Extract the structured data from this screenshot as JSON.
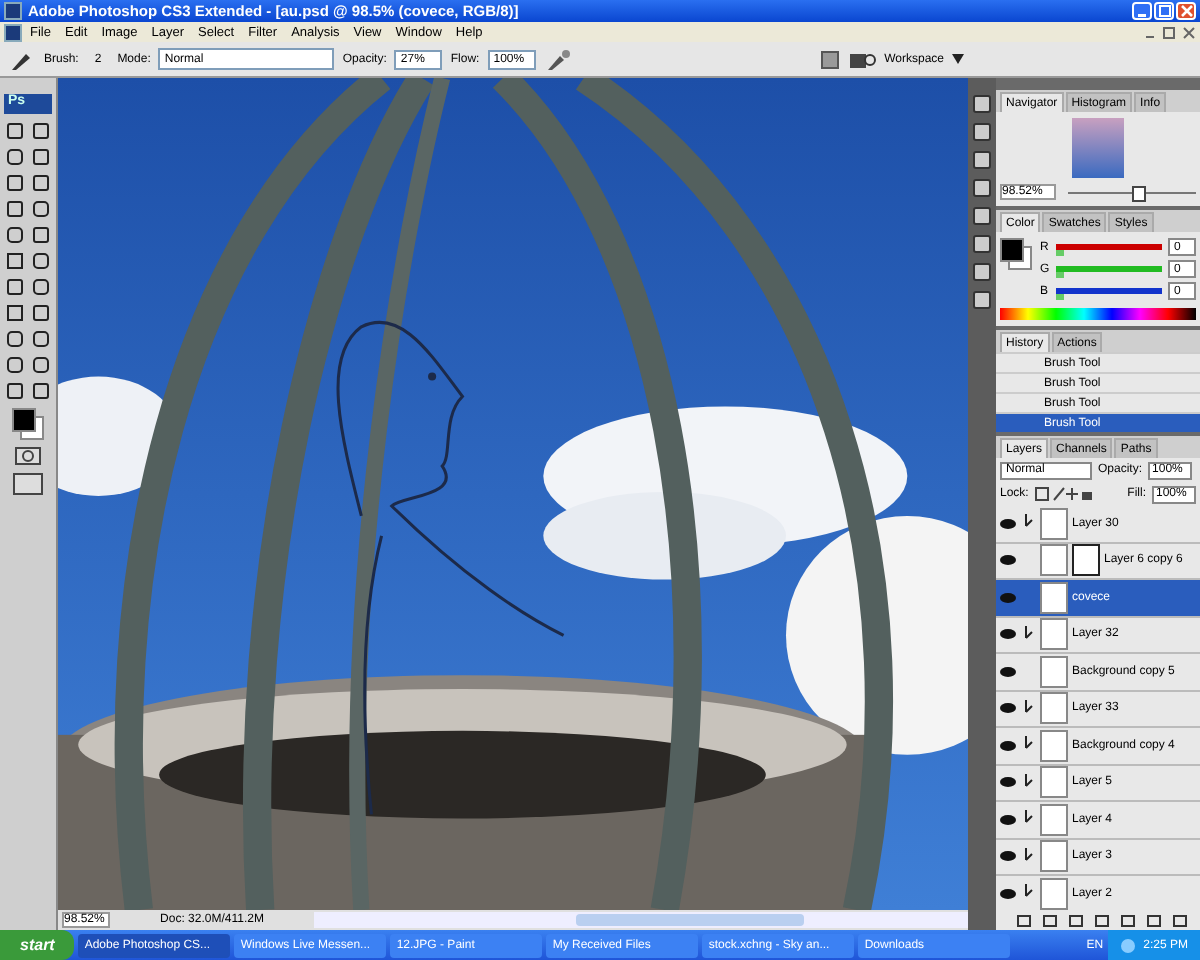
{
  "window": {
    "title": "Adobe Photoshop CS3 Extended - [au.psd @ 98.5% (covece, RGB/8)]"
  },
  "menu": [
    "File",
    "Edit",
    "Image",
    "Layer",
    "Select",
    "Filter",
    "Analysis",
    "View",
    "Window",
    "Help"
  ],
  "options_bar": {
    "brush_label": "Brush:",
    "brush_size": "2",
    "mode_label": "Mode:",
    "mode": "Normal",
    "opacity_label": "Opacity:",
    "opacity": "27%",
    "flow_label": "Flow:",
    "flow": "100%",
    "workspace": "Workspace"
  },
  "toolbox": {
    "logo": "Ps"
  },
  "navigator": {
    "tabs": [
      {
        "label": "Navigator",
        "selected": true
      },
      {
        "label": "Histogram",
        "selected": false
      },
      {
        "label": "Info",
        "selected": false
      }
    ],
    "zoom": "98.52%",
    "level": 0.55
  },
  "color": {
    "tabs": [
      {
        "label": "Color",
        "selected": true
      },
      {
        "label": "Swatches",
        "selected": false
      },
      {
        "label": "Styles",
        "selected": false
      }
    ],
    "channels": [
      {
        "name": "R",
        "value": "0",
        "color": "#cc0000",
        "level": 0
      },
      {
        "name": "G",
        "value": "0",
        "color": "#22bb22",
        "level": 0
      },
      {
        "name": "B",
        "value": "0",
        "color": "#1133cc",
        "level": 0
      }
    ]
  },
  "history": {
    "tabs": [
      {
        "label": "History",
        "selected": true
      },
      {
        "label": "Actions",
        "selected": false
      }
    ],
    "items": [
      {
        "label": "Brush Tool",
        "selected": false
      },
      {
        "label": "Brush Tool",
        "selected": false
      },
      {
        "label": "Brush Tool",
        "selected": false
      },
      {
        "label": "Brush Tool",
        "selected": true
      }
    ]
  },
  "layers": {
    "tabs": [
      {
        "label": "Layers",
        "selected": true
      },
      {
        "label": "Channels",
        "selected": false
      },
      {
        "label": "Paths",
        "selected": false
      }
    ],
    "blend_mode": "Normal",
    "opacity_label": "Opacity:",
    "opacity": "100%",
    "lock_label": "Lock:",
    "fill_label": "Fill:",
    "fill": "100%",
    "items": [
      {
        "name": "Layer 30",
        "visible": true,
        "clipped": true,
        "mask": false,
        "selected": false
      },
      {
        "name": "Layer 6 copy 6",
        "visible": true,
        "clipped": false,
        "mask": true,
        "selected": false
      },
      {
        "name": "covece",
        "visible": true,
        "clipped": false,
        "mask": false,
        "selected": true
      },
      {
        "name": "Layer 32",
        "visible": true,
        "clipped": true,
        "mask": false,
        "selected": false
      },
      {
        "name": "Background copy 5",
        "visible": true,
        "clipped": false,
        "mask": false,
        "selected": false
      },
      {
        "name": "Layer 33",
        "visible": true,
        "clipped": true,
        "mask": false,
        "selected": false
      },
      {
        "name": "Background copy 4",
        "visible": true,
        "clipped": true,
        "mask": false,
        "selected": false
      },
      {
        "name": "Layer 5",
        "visible": true,
        "clipped": true,
        "mask": false,
        "selected": false
      },
      {
        "name": "Layer 4",
        "visible": true,
        "clipped": true,
        "mask": false,
        "selected": false
      },
      {
        "name": "Layer 3",
        "visible": true,
        "clipped": true,
        "mask": false,
        "selected": false
      },
      {
        "name": "Layer 2",
        "visible": true,
        "clipped": true,
        "mask": false,
        "selected": false
      }
    ]
  },
  "status_bar": {
    "zoom": "98.52%",
    "doc": "Doc: 32.0M/411.2M"
  },
  "taskbar": {
    "start": "start",
    "tasks": [
      {
        "label": "Adobe Photoshop CS...",
        "selected": true
      },
      {
        "label": "Windows Live Messen...",
        "selected": false
      },
      {
        "label": "12.JPG - Paint",
        "selected": false
      },
      {
        "label": "My Received Files",
        "selected": false
      },
      {
        "label": "stock.xchng - Sky an...",
        "selected": false
      },
      {
        "label": "Downloads",
        "selected": false
      }
    ],
    "language": "EN",
    "clock": "2:25 PM"
  }
}
